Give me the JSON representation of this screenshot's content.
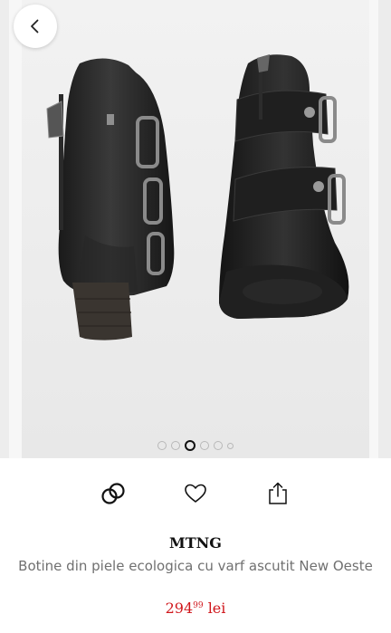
{
  "product": {
    "brand": "MTNG",
    "title": "Botine din piele ecologica cu varf ascutit New Oeste",
    "price_int": "294",
    "price_dec": "99",
    "currency": "lei",
    "image_alt": "Black ankle boots with buckle straps"
  },
  "gallery": {
    "total_images": 6,
    "active_index": 2
  },
  "icons": {
    "back": "chevron-left-icon",
    "compare": "link-rings-icon",
    "favorite": "heart-icon",
    "share": "share-icon"
  },
  "colors": {
    "price": "#d0161b",
    "brand_text": "#111111",
    "title_text": "#707070"
  }
}
